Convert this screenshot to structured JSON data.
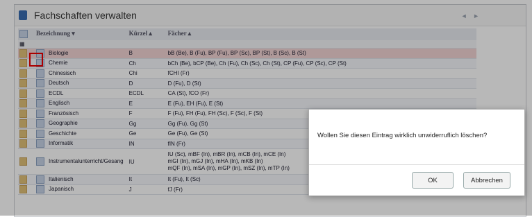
{
  "window": {
    "title": "Fachschaften verwalten",
    "nav_arrows": "◄ ►"
  },
  "table": {
    "headers": {
      "bezeichnung": "Bezeichnung ▾",
      "kuerzel": "Kürzel ▴",
      "faecher": "Fächer ▴"
    },
    "rows": [
      {
        "bezeichnung": "Biologie",
        "kuerzel": "B",
        "faecher": "bB (Be), B (Fu), BP (Fu), BP (Sc), BP (St), B (Sc), B (St)"
      },
      {
        "bezeichnung": "Chemie",
        "kuerzel": "Ch",
        "faecher": "bCh (Be), bCP (Be), Ch (Fu), Ch (Sc), Ch (St), CP (Fu), CP (Sc), CP (St)"
      },
      {
        "bezeichnung": "Chinesisch",
        "kuerzel": "Chi",
        "faecher": "fCHI (Fr)"
      },
      {
        "bezeichnung": "Deutsch",
        "kuerzel": "D",
        "faecher": "D (Fu), D (St)"
      },
      {
        "bezeichnung": "ECDL",
        "kuerzel": "ECDL",
        "faecher": "CA (St), fCO (Fr)"
      },
      {
        "bezeichnung": "Englisch",
        "kuerzel": "E",
        "faecher": "E (Fu), EH (Fu), E (St)"
      },
      {
        "bezeichnung": "Französisch",
        "kuerzel": "F",
        "faecher": "F (Fu), FH (Fu), FH (Sc), F (Sc), F (St)"
      },
      {
        "bezeichnung": "Geographie",
        "kuerzel": "Gg",
        "faecher": "Gg (Fu), Gg (St)"
      },
      {
        "bezeichnung": "Geschichte",
        "kuerzel": "Ge",
        "faecher": "Ge (Fu), Ge (St)"
      },
      {
        "bezeichnung": "Informatik",
        "kuerzel": "IN",
        "faecher": "fIN (Fr)"
      },
      {
        "bezeichnung": "Instrumentalunterricht/Gesang",
        "kuerzel": "IU",
        "faecher": "IU (Sc), mBF (In), mBR (In), mCB (In), mCE (In)",
        "faecher2": "mGI (In), mGJ (In), mHA (In), mKB (In)",
        "faecher3": "mQF (In), mSA (In), mGP (In), mSZ (In), mTP (In)"
      },
      {
        "bezeichnung": "Italienisch",
        "kuerzel": "It",
        "faecher": "It (Fu), It (Sc)"
      },
      {
        "bezeichnung": "Japanisch",
        "kuerzel": "J",
        "faecher": "fJ (Fr)"
      }
    ]
  },
  "dialog": {
    "message": "Wollen Sie diesen Eintrag wirklich unwiderruflich löschen?",
    "ok_label": "OK",
    "cancel_label": "Abbrechen"
  }
}
